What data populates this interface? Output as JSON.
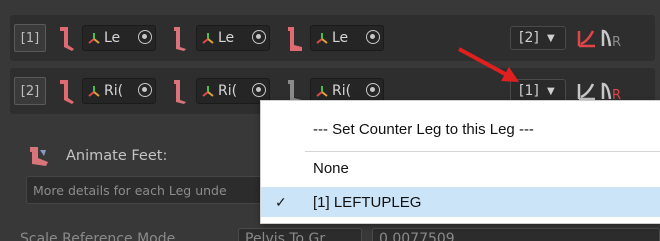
{
  "rows": [
    {
      "index": "[1]",
      "segments": [
        {
          "label": "Le"
        },
        {
          "label": "Le"
        },
        {
          "label": "Le"
        }
      ],
      "counter_value": "[2]"
    },
    {
      "index": "[2]",
      "segments": [
        {
          "label": "Ri("
        },
        {
          "label": "Ri("
        },
        {
          "label": "Ri("
        }
      ],
      "counter_value": "[1]"
    }
  ],
  "animate_feet_label": "Animate Feet:",
  "details_text": "More details for each Leg unde",
  "bottom": {
    "label": "Scale Reference Mode",
    "mode": "Pelvis To Gr",
    "value": "0.0077509"
  },
  "menu": {
    "header": "--- Set Counter Leg to this Leg ---",
    "items": [
      {
        "label": "None",
        "checked": false
      },
      {
        "label": "[1] LEFTUPLEG",
        "checked": true,
        "check": "✓"
      }
    ]
  },
  "colors": {
    "leg_active": "#e06a72",
    "leg_mid": "#d9747a",
    "leg_inactive": "#8a8a8a",
    "arrow": "#e02020",
    "menu_highlight": "#cce4f7",
    "curve_red": "#e0454a"
  },
  "icons": {
    "leg": "leg-bone-icon",
    "bone": "bone-handle-icon",
    "target": "object-picker-icon",
    "curve": "curve-icon",
    "feet": "foot-icon"
  }
}
